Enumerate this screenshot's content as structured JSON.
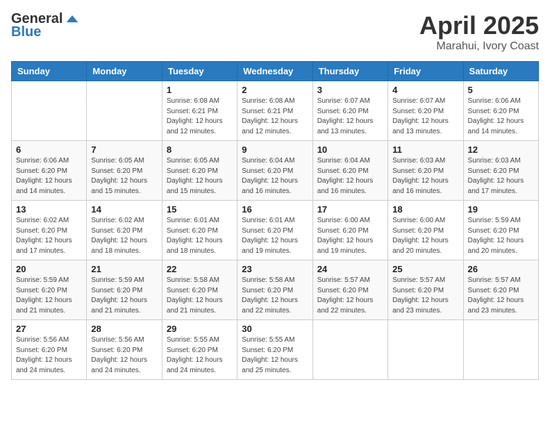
{
  "logo": {
    "general": "General",
    "blue": "Blue"
  },
  "title": "April 2025",
  "location": "Marahui, Ivory Coast",
  "days_of_week": [
    "Sunday",
    "Monday",
    "Tuesday",
    "Wednesday",
    "Thursday",
    "Friday",
    "Saturday"
  ],
  "weeks": [
    [
      {
        "day": "",
        "info": ""
      },
      {
        "day": "",
        "info": ""
      },
      {
        "day": "1",
        "info": "Sunrise: 6:08 AM\nSunset: 6:21 PM\nDaylight: 12 hours and 12 minutes."
      },
      {
        "day": "2",
        "info": "Sunrise: 6:08 AM\nSunset: 6:21 PM\nDaylight: 12 hours and 12 minutes."
      },
      {
        "day": "3",
        "info": "Sunrise: 6:07 AM\nSunset: 6:20 PM\nDaylight: 12 hours and 13 minutes."
      },
      {
        "day": "4",
        "info": "Sunrise: 6:07 AM\nSunset: 6:20 PM\nDaylight: 12 hours and 13 minutes."
      },
      {
        "day": "5",
        "info": "Sunrise: 6:06 AM\nSunset: 6:20 PM\nDaylight: 12 hours and 14 minutes."
      }
    ],
    [
      {
        "day": "6",
        "info": "Sunrise: 6:06 AM\nSunset: 6:20 PM\nDaylight: 12 hours and 14 minutes."
      },
      {
        "day": "7",
        "info": "Sunrise: 6:05 AM\nSunset: 6:20 PM\nDaylight: 12 hours and 15 minutes."
      },
      {
        "day": "8",
        "info": "Sunrise: 6:05 AM\nSunset: 6:20 PM\nDaylight: 12 hours and 15 minutes."
      },
      {
        "day": "9",
        "info": "Sunrise: 6:04 AM\nSunset: 6:20 PM\nDaylight: 12 hours and 16 minutes."
      },
      {
        "day": "10",
        "info": "Sunrise: 6:04 AM\nSunset: 6:20 PM\nDaylight: 12 hours and 16 minutes."
      },
      {
        "day": "11",
        "info": "Sunrise: 6:03 AM\nSunset: 6:20 PM\nDaylight: 12 hours and 16 minutes."
      },
      {
        "day": "12",
        "info": "Sunrise: 6:03 AM\nSunset: 6:20 PM\nDaylight: 12 hours and 17 minutes."
      }
    ],
    [
      {
        "day": "13",
        "info": "Sunrise: 6:02 AM\nSunset: 6:20 PM\nDaylight: 12 hours and 17 minutes."
      },
      {
        "day": "14",
        "info": "Sunrise: 6:02 AM\nSunset: 6:20 PM\nDaylight: 12 hours and 18 minutes."
      },
      {
        "day": "15",
        "info": "Sunrise: 6:01 AM\nSunset: 6:20 PM\nDaylight: 12 hours and 18 minutes."
      },
      {
        "day": "16",
        "info": "Sunrise: 6:01 AM\nSunset: 6:20 PM\nDaylight: 12 hours and 19 minutes."
      },
      {
        "day": "17",
        "info": "Sunrise: 6:00 AM\nSunset: 6:20 PM\nDaylight: 12 hours and 19 minutes."
      },
      {
        "day": "18",
        "info": "Sunrise: 6:00 AM\nSunset: 6:20 PM\nDaylight: 12 hours and 20 minutes."
      },
      {
        "day": "19",
        "info": "Sunrise: 5:59 AM\nSunset: 6:20 PM\nDaylight: 12 hours and 20 minutes."
      }
    ],
    [
      {
        "day": "20",
        "info": "Sunrise: 5:59 AM\nSunset: 6:20 PM\nDaylight: 12 hours and 21 minutes."
      },
      {
        "day": "21",
        "info": "Sunrise: 5:59 AM\nSunset: 6:20 PM\nDaylight: 12 hours and 21 minutes."
      },
      {
        "day": "22",
        "info": "Sunrise: 5:58 AM\nSunset: 6:20 PM\nDaylight: 12 hours and 21 minutes."
      },
      {
        "day": "23",
        "info": "Sunrise: 5:58 AM\nSunset: 6:20 PM\nDaylight: 12 hours and 22 minutes."
      },
      {
        "day": "24",
        "info": "Sunrise: 5:57 AM\nSunset: 6:20 PM\nDaylight: 12 hours and 22 minutes."
      },
      {
        "day": "25",
        "info": "Sunrise: 5:57 AM\nSunset: 6:20 PM\nDaylight: 12 hours and 23 minutes."
      },
      {
        "day": "26",
        "info": "Sunrise: 5:57 AM\nSunset: 6:20 PM\nDaylight: 12 hours and 23 minutes."
      }
    ],
    [
      {
        "day": "27",
        "info": "Sunrise: 5:56 AM\nSunset: 6:20 PM\nDaylight: 12 hours and 24 minutes."
      },
      {
        "day": "28",
        "info": "Sunrise: 5:56 AM\nSunset: 6:20 PM\nDaylight: 12 hours and 24 minutes."
      },
      {
        "day": "29",
        "info": "Sunrise: 5:55 AM\nSunset: 6:20 PM\nDaylight: 12 hours and 24 minutes."
      },
      {
        "day": "30",
        "info": "Sunrise: 5:55 AM\nSunset: 6:20 PM\nDaylight: 12 hours and 25 minutes."
      },
      {
        "day": "",
        "info": ""
      },
      {
        "day": "",
        "info": ""
      },
      {
        "day": "",
        "info": ""
      }
    ]
  ]
}
